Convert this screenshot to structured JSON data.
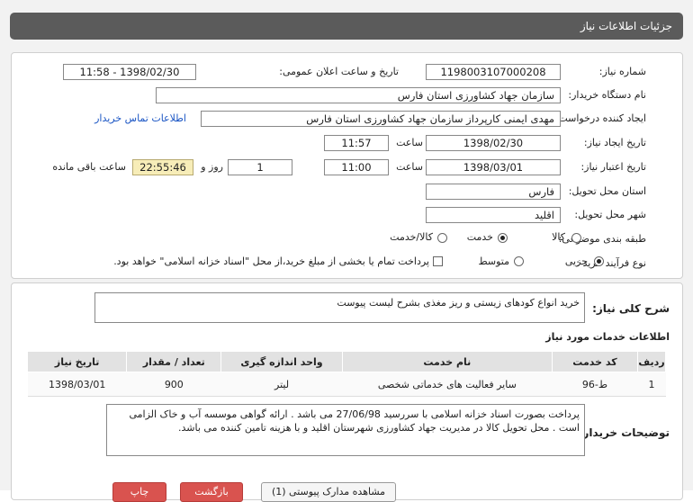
{
  "header": {
    "title": "جزئیات اطلاعات نیاز"
  },
  "form": {
    "need_number": {
      "label": "شماره نیاز:",
      "value": "1198003107000208"
    },
    "announce_datetime": {
      "label": "تاریخ و ساعت اعلان عمومی:",
      "value": "1398/02/30 - 11:58"
    },
    "buyer_org": {
      "label": "نام دستگاه خریدار:",
      "value": "سازمان جهاد کشاورزی استان فارس"
    },
    "requester": {
      "label": "ایجاد کننده درخواست:",
      "value": "مهدی ایمنی کارپرداز سازمان جهاد کشاورزی استان فارس",
      "contact_link": "اطلاعات تماس خریدار"
    },
    "created": {
      "label": "تاریخ ایجاد نیاز:",
      "date": "1398/02/30",
      "time_label": "ساعت",
      "time": "11:57"
    },
    "validity": {
      "label": "تاریخ اعتبار نیاز:",
      "date": "1398/03/01",
      "time_label": "ساعت",
      "time": "11:00",
      "days": "1",
      "days_label": "روز و",
      "remaining": "22:55:46",
      "remaining_label": "ساعت باقی مانده"
    },
    "province": {
      "label": "استان محل تحویل:",
      "value": "فارس"
    },
    "city": {
      "label": "شهر محل تحویل:",
      "value": "اقلید"
    },
    "category": {
      "label": "طبقه بندی موضوعی:",
      "options": [
        "کالا",
        "خدمت",
        "کالا/خدمت"
      ],
      "selected": "خدمت"
    },
    "process": {
      "label": "نوع فرآیند خرید :",
      "options": [
        "جزیی",
        "متوسط"
      ],
      "selected": "جزیی",
      "treasury_note": "پرداخت تمام یا بخشی از مبلغ خرید،از محل \"اسناد خزانه اسلامی\" خواهد بود."
    }
  },
  "summary": {
    "label": "شرح کلی نیاز:",
    "value": "خرید انواع کودهای زیستی و ریز مغذی بشرح لیست پیوست"
  },
  "services": {
    "title": "اطلاعات خدمات مورد نیاز",
    "columns": [
      "ردیف",
      "کد خدمت",
      "نام خدمت",
      "واحد اندازه گیری",
      "تعداد / مقدار",
      "تاریخ نیاز"
    ],
    "rows": [
      [
        "1",
        "ط-96",
        "سایر فعالیت های خدماتی شخصی",
        "لیتر",
        "900",
        "1398/03/01"
      ]
    ]
  },
  "buyer_notes": {
    "label": "توضیحات خریدار:",
    "value": "پرداخت بصورت اسناد خزانه اسلامی با سررسید 27/06/98 می باشد . ارائه گواهی موسسه آب و خاک الزامی است . محل تحویل کالا در مدیریت جهاد کشاورزی شهرستان اقلید و با هزینه تامین کننده می باشد."
  },
  "footer_buttons": [
    "مشاهده مدارک پیوستی (1)",
    "بازگشت",
    "چاپ"
  ]
}
